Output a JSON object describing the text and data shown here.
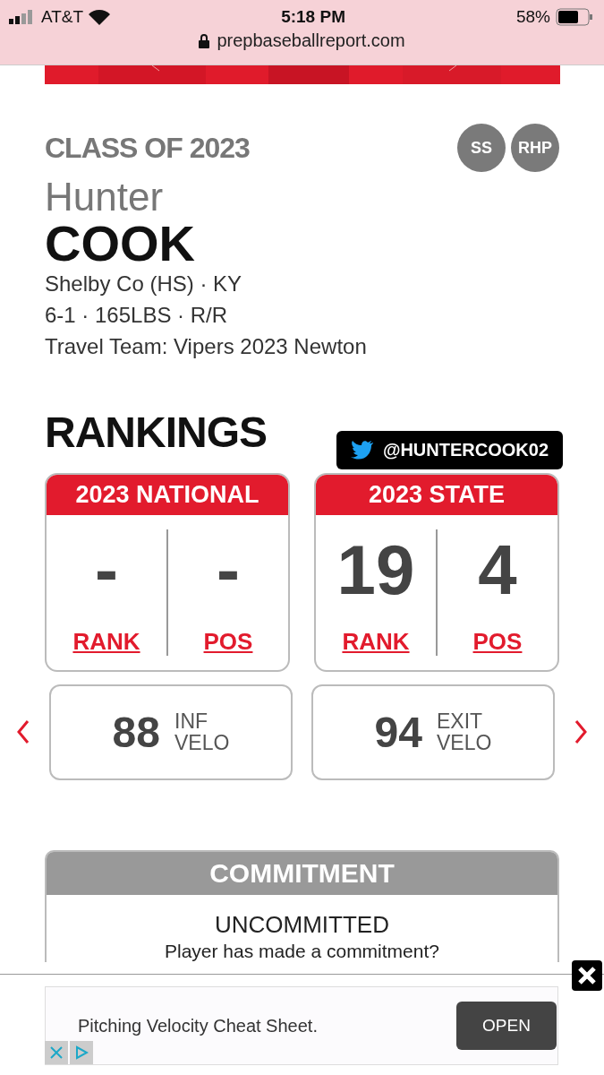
{
  "status_bar": {
    "carrier": "AT&T",
    "time": "5:18 PM",
    "battery": "58%"
  },
  "address_bar": {
    "url": "prepbaseballreport.com"
  },
  "player": {
    "class": "CLASS OF 2023",
    "positions": [
      "SS",
      "RHP"
    ],
    "first_name": "Hunter",
    "last_name": "COOK",
    "details": [
      "Shelby Co (HS) · KY",
      "6-1 · 165LBS · R/R",
      "Travel Team: Vipers 2023 Newton"
    ]
  },
  "rankings": {
    "title": "RANKINGS",
    "twitter": "@HUNTERCOOK02",
    "cards": [
      {
        "title": "2023 NATIONAL",
        "stats": [
          {
            "value": "-",
            "label": "RANK"
          },
          {
            "value": "-",
            "label": "POS"
          }
        ]
      },
      {
        "title": "2023 STATE",
        "stats": [
          {
            "value": "19",
            "label": "RANK"
          },
          {
            "value": "4",
            "label": "POS"
          }
        ]
      }
    ]
  },
  "velocity": [
    {
      "value": "88",
      "label": [
        "INF",
        "VELO"
      ]
    },
    {
      "value": "94",
      "label": [
        "EXIT",
        "VELO"
      ]
    }
  ],
  "commitment": {
    "title": "COMMITMENT",
    "status": "UNCOMMITTED",
    "question": "Player has made a commitment?"
  },
  "ad": {
    "text": "Pitching Velocity Cheat Sheet.",
    "button": "OPEN"
  }
}
